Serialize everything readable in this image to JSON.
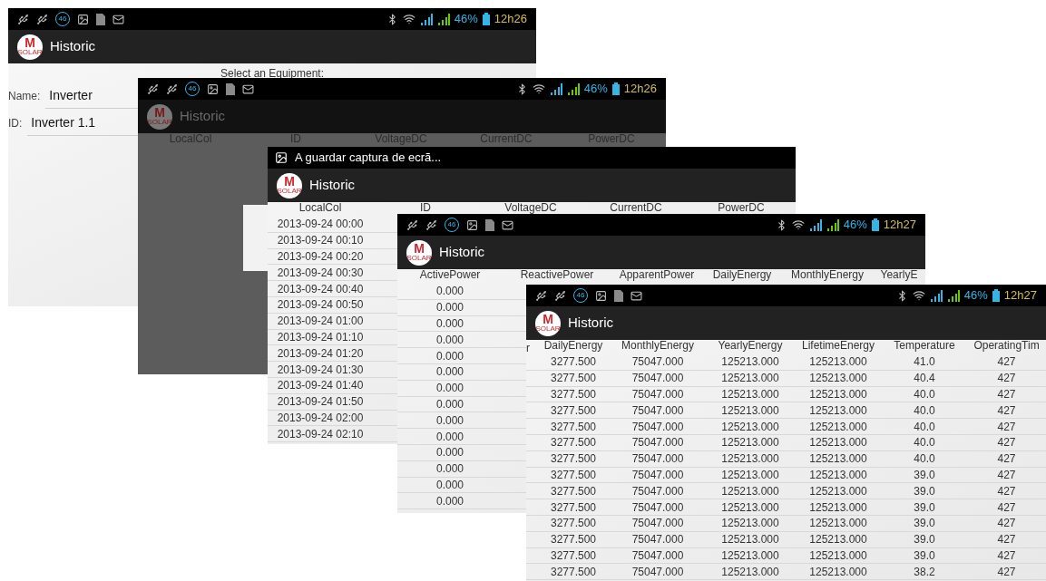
{
  "screens": [
    {
      "kind": "form",
      "status": {
        "badge": "46",
        "battery": "46%",
        "time": "12h26"
      },
      "logo": {
        "letter": "M",
        "caption": "SOLAR"
      },
      "title": "Historic",
      "dimmed": false,
      "prompt": "Select an Equipment:",
      "fields": [
        {
          "label": "Name:",
          "value": "Inverter"
        },
        {
          "label": "ID:",
          "value": "Inverter 1.1"
        }
      ]
    },
    {
      "kind": "table",
      "status": {
        "badge": "46",
        "battery": "46%",
        "time": "12h26"
      },
      "logo": {
        "letter": "M",
        "caption": "SOLAR"
      },
      "title": "Historic",
      "dimmed": true,
      "columns": [
        "LocalCol",
        "ID",
        "VoltageDC",
        "CurrentDC",
        "PowerDC"
      ]
    },
    {
      "kind": "table",
      "notification": "A guardar captura de ecrã...",
      "logo": {
        "letter": "M",
        "caption": "SOLAR"
      },
      "title": "Historic",
      "dimmed": false,
      "columns": [
        "LocalCol",
        "ID",
        "VoltageDC",
        "CurrentDC",
        "PowerDC"
      ],
      "rows": [
        [
          "2013-09-24 00:00"
        ],
        [
          "2013-09-24 00:10"
        ],
        [
          "2013-09-24 00:20"
        ],
        [
          "2013-09-24 00:30"
        ],
        [
          "2013-09-24 00:40"
        ],
        [
          "2013-09-24 00:50"
        ],
        [
          "2013-09-24 01:00"
        ],
        [
          "2013-09-24 01:10"
        ],
        [
          "2013-09-24 01:20"
        ],
        [
          "2013-09-24 01:30"
        ],
        [
          "2013-09-24 01:40"
        ],
        [
          "2013-09-24 01:50"
        ],
        [
          "2013-09-24 02:00"
        ],
        [
          "2013-09-24 02:10"
        ]
      ]
    },
    {
      "kind": "table",
      "status": {
        "badge": "46",
        "battery": "46%",
        "time": "12h27"
      },
      "logo": {
        "letter": "M",
        "caption": "SOLAR"
      },
      "title": "Historic",
      "dimmed": false,
      "columns": [
        "ActivePower",
        "ReactivePower",
        "ApparentPower",
        "DailyEnergy",
        "MonthlyEnergy",
        "YearlyE"
      ],
      "rows": [
        [
          "0.000"
        ],
        [
          "0.000"
        ],
        [
          "0.000"
        ],
        [
          "0.000"
        ],
        [
          "0.000"
        ],
        [
          "0.000"
        ],
        [
          "0.000"
        ],
        [
          "0.000"
        ],
        [
          "0.000"
        ],
        [
          "0.000"
        ],
        [
          "0.000"
        ],
        [
          "0.000"
        ],
        [
          "0.000"
        ],
        [
          "0.000"
        ]
      ]
    },
    {
      "kind": "table",
      "status": {
        "badge": "46",
        "battery": "46%",
        "time": "12h27"
      },
      "logo": {
        "letter": "M",
        "caption": "SOLAR"
      },
      "title": "Historic",
      "dimmed": false,
      "partial_header": "r",
      "columns": [
        "DailyEnergy",
        "MonthlyEnergy",
        "YearlyEnergy",
        "LifetimeEnergy",
        "Temperature",
        "OperatingTim"
      ],
      "rows": [
        [
          "3277.500",
          "75047.000",
          "125213.000",
          "125213.000",
          "41.0",
          "427"
        ],
        [
          "3277.500",
          "75047.000",
          "125213.000",
          "125213.000",
          "40.4",
          "427"
        ],
        [
          "3277.500",
          "75047.000",
          "125213.000",
          "125213.000",
          "40.0",
          "427"
        ],
        [
          "3277.500",
          "75047.000",
          "125213.000",
          "125213.000",
          "40.0",
          "427"
        ],
        [
          "3277.500",
          "75047.000",
          "125213.000",
          "125213.000",
          "40.0",
          "427"
        ],
        [
          "3277.500",
          "75047.000",
          "125213.000",
          "125213.000",
          "40.0",
          "427"
        ],
        [
          "3277.500",
          "75047.000",
          "125213.000",
          "125213.000",
          "40.0",
          "427"
        ],
        [
          "3277.500",
          "75047.000",
          "125213.000",
          "125213.000",
          "39.0",
          "427"
        ],
        [
          "3277.500",
          "75047.000",
          "125213.000",
          "125213.000",
          "39.0",
          "427"
        ],
        [
          "3277.500",
          "75047.000",
          "125213.000",
          "125213.000",
          "39.0",
          "427"
        ],
        [
          "3277.500",
          "75047.000",
          "125213.000",
          "125213.000",
          "39.0",
          "427"
        ],
        [
          "3277.500",
          "75047.000",
          "125213.000",
          "125213.000",
          "39.0",
          "427"
        ],
        [
          "3277.500",
          "75047.000",
          "125213.000",
          "125213.000",
          "39.0",
          "427"
        ],
        [
          "3277.500",
          "75047.000",
          "125213.000",
          "125213.000",
          "38.2",
          "427"
        ]
      ]
    }
  ]
}
